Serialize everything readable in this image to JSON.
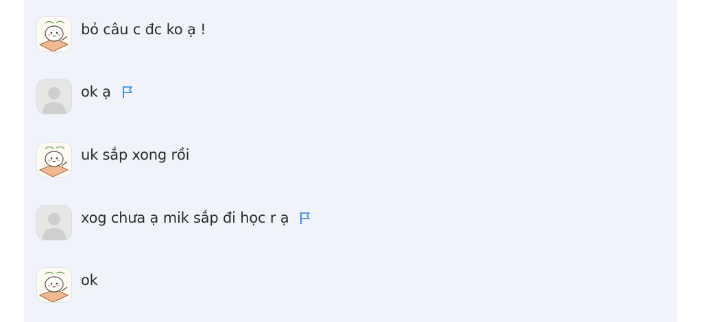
{
  "messages": [
    {
      "avatar": "sticker",
      "text": "bỏ câu c đc ko ạ !",
      "flag": false
    },
    {
      "avatar": "default",
      "text": "ok ạ",
      "flag": true
    },
    {
      "avatar": "sticker",
      "text": "uk sắp xong rồi",
      "flag": false
    },
    {
      "avatar": "default",
      "text": "xog chưa ạ mik sắp đi học r ạ",
      "flag": true
    },
    {
      "avatar": "sticker",
      "text": "ok",
      "flag": false
    }
  ],
  "icons": {
    "flag": "flag-icon",
    "default_avatar": "default-user-icon",
    "sticker_avatar": "cartoon-cat-icon"
  },
  "colors": {
    "panel_bg": "#f0f4fa",
    "flag": "#3d8ee6",
    "text": "#2b2b2b"
  }
}
